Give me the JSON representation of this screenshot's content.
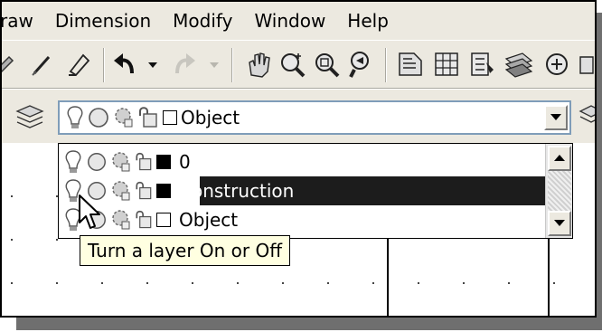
{
  "menubar": {
    "items": [
      "raw",
      "Dimension",
      "Modify",
      "Window",
      "Help"
    ]
  },
  "toolbar": {
    "icons": [
      "draw-tool-icon",
      "pencil-icon",
      "match-properties-icon",
      "undo-icon",
      "undo-dropdown-icon",
      "redo-icon",
      "redo-dropdown-icon",
      "pan-icon",
      "zoom-realtime-icon",
      "zoom-window-icon",
      "zoom-previous-icon",
      "properties-icon",
      "design-center-icon",
      "tool-palettes-icon",
      "sheet-set-icon",
      "markup-icon"
    ]
  },
  "layers_toolbar": {
    "current_layer": "Object"
  },
  "layer_list": {
    "items": [
      {
        "name": "0",
        "color": "#000000",
        "selected": false
      },
      {
        "name": "Construction",
        "color": "#000000",
        "selected": true
      },
      {
        "name": "Object",
        "color": "#ffffff",
        "selected": false
      }
    ]
  },
  "tooltip": {
    "text": "Turn a layer On or Off"
  },
  "colors": {
    "chrome": "#ece9e0",
    "selection": "#1c1c1c",
    "tooltip_bg": "#ffffe1"
  }
}
